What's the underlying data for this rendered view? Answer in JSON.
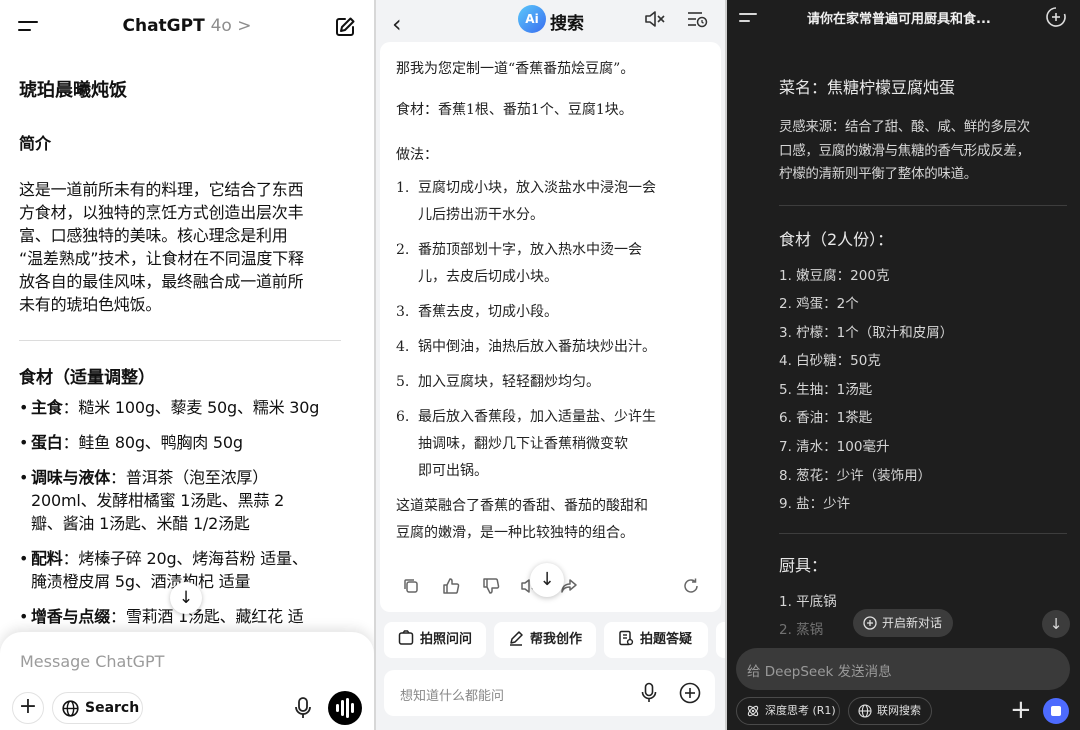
{
  "chatgpt": {
    "header": {
      "title": "ChatGPT",
      "model": "4o >"
    },
    "recipe_title": "琥珀晨曦炖饭",
    "intro_heading": "简介",
    "intro_lines": [
      "这是一道前所未有的料理，它结合了东西",
      "方食材，以独特的烹饪方式创造出层次丰",
      "富、口感独特的美味。核心理念是利用",
      "“温差熟成”技术，让食材在不同温度下释",
      "放各自的最佳风味，最终融合成一道前所",
      "未有的琥珀色炖饭。"
    ],
    "ingredients_heading": "食材（适量调整）",
    "ingredients": [
      {
        "label": "主食",
        "lines": [
          "：糙米 100g、藜麦 50g、糯米 30g"
        ]
      },
      {
        "label": "蛋白",
        "lines": [
          "：鲑鱼 80g、鸭胸肉 50g"
        ]
      },
      {
        "label": "调味与液体",
        "lines": [
          "：普洱茶（泡至浓厚）",
          "200ml、发酵柑橘蜜 1汤匙、黑蒜 2",
          "瓣、酱油 1汤匙、米醋 1/2汤匙"
        ]
      },
      {
        "label": "配料",
        "lines": [
          "：烤榛子碎 20g、烤海苔粉 适量、",
          "腌渍橙皮屑 5g、酒渍枸杞 适量"
        ]
      },
      {
        "label": "增香与点缀",
        "lines": [
          "：雪莉酒 1汤匙、藏红花 适"
        ]
      }
    ],
    "composer": {
      "placeholder": "Message ChatGPT",
      "search_label": "Search"
    }
  },
  "aisearch": {
    "header": {
      "logo": "Ai",
      "title": "搜索"
    },
    "intro": "那我为您定制一道“香蕉番茄烩豆腐”。",
    "ingredients": "食材：香蕉1根、番茄1个、豆腐1块。",
    "method_heading": "做法：",
    "steps": [
      {
        "n": "1.",
        "lines": [
          "豆腐切成小块，放入淡盐水中浸泡一会",
          "儿后捞出沥干水分。"
        ]
      },
      {
        "n": "2.",
        "lines": [
          "番茄顶部划十字，放入热水中烫一会",
          "儿，去皮后切成小块。"
        ]
      },
      {
        "n": "3.",
        "lines": [
          "香蕉去皮，切成小段。"
        ]
      },
      {
        "n": "4.",
        "lines": [
          "锅中倒油，油热后放入番茄块炒出汁。"
        ]
      },
      {
        "n": "5.",
        "lines": [
          "加入豆腐块，轻轻翻炒均匀。"
        ]
      },
      {
        "n": "6.",
        "lines": [
          "最后放入香蕉段，加入适量盐、少许生",
          "抽调味，翻炒几下让香蕉稍微变软",
          "即可出锅。"
        ]
      }
    ],
    "summary_lines": [
      "这道菜融合了香蕉的香甜、番茄的酸甜和",
      "豆腐的嫩滑，是一种比较独特的组合。"
    ],
    "chips": [
      "拍照问问",
      "帮我创作",
      "拍题答疑"
    ],
    "input_placeholder": "想知道什么都能问"
  },
  "deepseek": {
    "header": {
      "title": "请你在家常普遍可用厨具和食..."
    },
    "dish_name": "菜名：焦糖柠檬豆腐炖蛋",
    "inspiration_lines": [
      "灵感来源：结合了甜、酸、咸、鲜的多层次",
      "口感，豆腐的嫩滑与焦糖的香气形成反差，",
      "柠檬的清新则平衡了整体的味道。"
    ],
    "ingredients_heading": "食材（2人份）：",
    "ingredients": [
      "1. 嫩豆腐：200克",
      "2. 鸡蛋：2个",
      "3. 柠檬：1个（取汁和皮屑）",
      "4. 白砂糖：50克",
      "5. 生抽：1汤匙",
      "6. 香油：1茶匙",
      "7. 清水：100毫升",
      "8. 葱花：少许（装饰用）",
      "9. 盐：少许"
    ],
    "tools_heading": "厨具：",
    "tools": [
      "1. 平底锅",
      "2. 蒸锅"
    ],
    "new_chat_label": "开启新对话",
    "input_placeholder": "给 DeepSeek 发送消息",
    "deep_think_label": "深度思考 (R1)",
    "web_search_label": "联网搜索",
    "accent_color": "#4d6bfe"
  }
}
